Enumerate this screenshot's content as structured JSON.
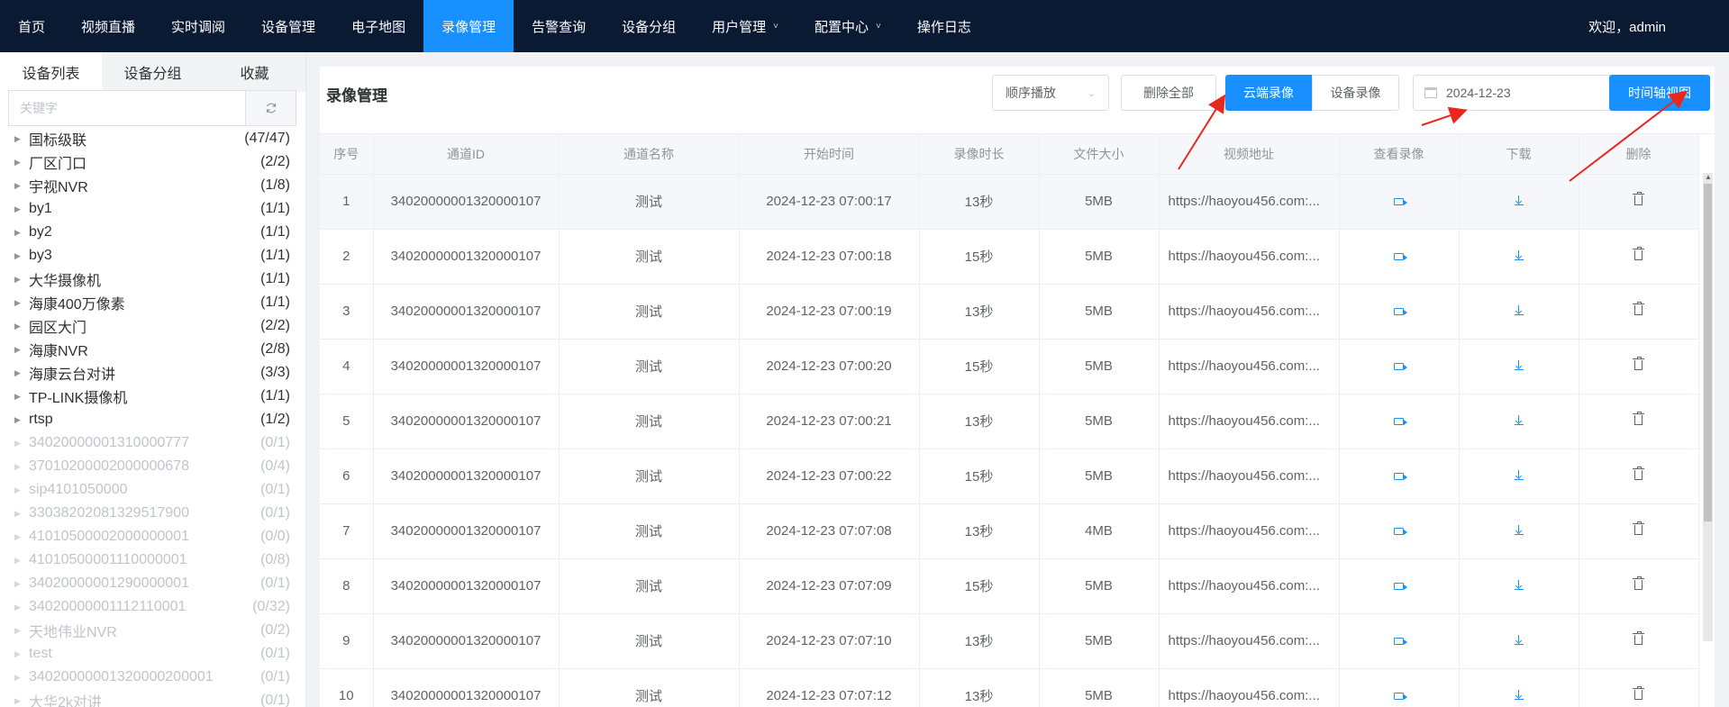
{
  "nav": {
    "items": [
      {
        "label": "首页",
        "active": false,
        "dropdown": false
      },
      {
        "label": "视频直播",
        "active": false,
        "dropdown": false
      },
      {
        "label": "实时调阅",
        "active": false,
        "dropdown": false
      },
      {
        "label": "设备管理",
        "active": false,
        "dropdown": false
      },
      {
        "label": "电子地图",
        "active": false,
        "dropdown": false
      },
      {
        "label": "录像管理",
        "active": true,
        "dropdown": false
      },
      {
        "label": "告警查询",
        "active": false,
        "dropdown": false
      },
      {
        "label": "设备分组",
        "active": false,
        "dropdown": false
      },
      {
        "label": "用户管理",
        "active": false,
        "dropdown": true
      },
      {
        "label": "配置中心",
        "active": false,
        "dropdown": true
      },
      {
        "label": "操作日志",
        "active": false,
        "dropdown": false
      }
    ],
    "welcome": "欢迎，admin"
  },
  "sidebar": {
    "tabs": [
      "设备列表",
      "设备分组",
      "收藏"
    ],
    "search_placeholder": "关键字",
    "tree": [
      {
        "name": "国标级联",
        "count": "(47/47)",
        "online": true
      },
      {
        "name": "厂区门口",
        "count": "(2/2)",
        "online": true
      },
      {
        "name": "宇视NVR",
        "count": "(1/8)",
        "online": true
      },
      {
        "name": "by1",
        "count": "(1/1)",
        "online": true
      },
      {
        "name": "by2",
        "count": "(1/1)",
        "online": true
      },
      {
        "name": "by3",
        "count": "(1/1)",
        "online": true
      },
      {
        "name": "大华摄像机",
        "count": "(1/1)",
        "online": true
      },
      {
        "name": "海康400万像素",
        "count": "(1/1)",
        "online": true
      },
      {
        "name": "园区大门",
        "count": "(2/2)",
        "online": true
      },
      {
        "name": "海康NVR",
        "count": "(2/8)",
        "online": true
      },
      {
        "name": "海康云台对讲",
        "count": "(3/3)",
        "online": true
      },
      {
        "name": "TP-LINK摄像机",
        "count": "(1/1)",
        "online": true
      },
      {
        "name": "rtsp",
        "count": "(1/2)",
        "online": true
      },
      {
        "name": "34020000001310000777",
        "count": "(0/1)",
        "online": false
      },
      {
        "name": "37010200002000000678",
        "count": "(0/4)",
        "online": false
      },
      {
        "name": "sip4101050000",
        "count": "(0/1)",
        "online": false
      },
      {
        "name": "33038202081329517900",
        "count": "(0/1)",
        "online": false
      },
      {
        "name": "41010500002000000001",
        "count": "(0/0)",
        "online": false
      },
      {
        "name": "41010500001110000001",
        "count": "(0/8)",
        "online": false
      },
      {
        "name": "34020000001290000001",
        "count": "(0/1)",
        "online": false
      },
      {
        "name": "34020000001112110001",
        "count": "(0/32)",
        "online": false
      },
      {
        "name": "天地伟业NVR",
        "count": "(0/2)",
        "online": false
      },
      {
        "name": "test",
        "count": "(0/1)",
        "online": false
      },
      {
        "name": "34020000001320000200001",
        "count": "(0/1)",
        "online": false
      },
      {
        "name": "大华2k对讲",
        "count": "(0/1)",
        "online": false
      }
    ]
  },
  "main": {
    "title": "录像管理",
    "play_mode": "顺序播放",
    "delete_all": "删除全部",
    "cloud_record": "云端录像",
    "device_record": "设备录像",
    "date": "2024-12-23",
    "timeline_view": "时间轴视图",
    "columns": [
      "序号",
      "通道ID",
      "通道名称",
      "开始时间",
      "录像时长",
      "文件大小",
      "视频地址",
      "查看录像",
      "下载",
      "删除"
    ],
    "rows": [
      {
        "no": "1",
        "channel_id": "34020000001320000107",
        "channel_name": "测试",
        "start_time": "2024-12-23 07:00:17",
        "duration": "13秒",
        "size": "5MB",
        "url": "https://haoyou456.com:..."
      },
      {
        "no": "2",
        "channel_id": "34020000001320000107",
        "channel_name": "测试",
        "start_time": "2024-12-23 07:00:18",
        "duration": "15秒",
        "size": "5MB",
        "url": "https://haoyou456.com:..."
      },
      {
        "no": "3",
        "channel_id": "34020000001320000107",
        "channel_name": "测试",
        "start_time": "2024-12-23 07:00:19",
        "duration": "13秒",
        "size": "5MB",
        "url": "https://haoyou456.com:..."
      },
      {
        "no": "4",
        "channel_id": "34020000001320000107",
        "channel_name": "测试",
        "start_time": "2024-12-23 07:00:20",
        "duration": "15秒",
        "size": "5MB",
        "url": "https://haoyou456.com:..."
      },
      {
        "no": "5",
        "channel_id": "34020000001320000107",
        "channel_name": "测试",
        "start_time": "2024-12-23 07:00:21",
        "duration": "13秒",
        "size": "5MB",
        "url": "https://haoyou456.com:..."
      },
      {
        "no": "6",
        "channel_id": "34020000001320000107",
        "channel_name": "测试",
        "start_time": "2024-12-23 07:00:22",
        "duration": "15秒",
        "size": "5MB",
        "url": "https://haoyou456.com:..."
      },
      {
        "no": "7",
        "channel_id": "34020000001320000107",
        "channel_name": "测试",
        "start_time": "2024-12-23 07:07:08",
        "duration": "13秒",
        "size": "4MB",
        "url": "https://haoyou456.com:..."
      },
      {
        "no": "8",
        "channel_id": "34020000001320000107",
        "channel_name": "测试",
        "start_time": "2024-12-23 07:07:09",
        "duration": "15秒",
        "size": "5MB",
        "url": "https://haoyou456.com:..."
      },
      {
        "no": "9",
        "channel_id": "34020000001320000107",
        "channel_name": "测试",
        "start_time": "2024-12-23 07:07:10",
        "duration": "13秒",
        "size": "5MB",
        "url": "https://haoyou456.com:..."
      },
      {
        "no": "10",
        "channel_id": "34020000001320000107",
        "channel_name": "测试",
        "start_time": "2024-12-23 07:07:12",
        "duration": "13秒",
        "size": "5MB",
        "url": "https://haoyou456.com:..."
      }
    ]
  },
  "icons": {
    "view": "video-camera-icon",
    "download": "download-icon",
    "delete": "trash-icon",
    "refresh": "refresh-icon",
    "calendar": "calendar-icon"
  },
  "colors": {
    "nav_bg": "#0a1a33",
    "accent": "#1890ff",
    "annotation": "#e8281e"
  }
}
